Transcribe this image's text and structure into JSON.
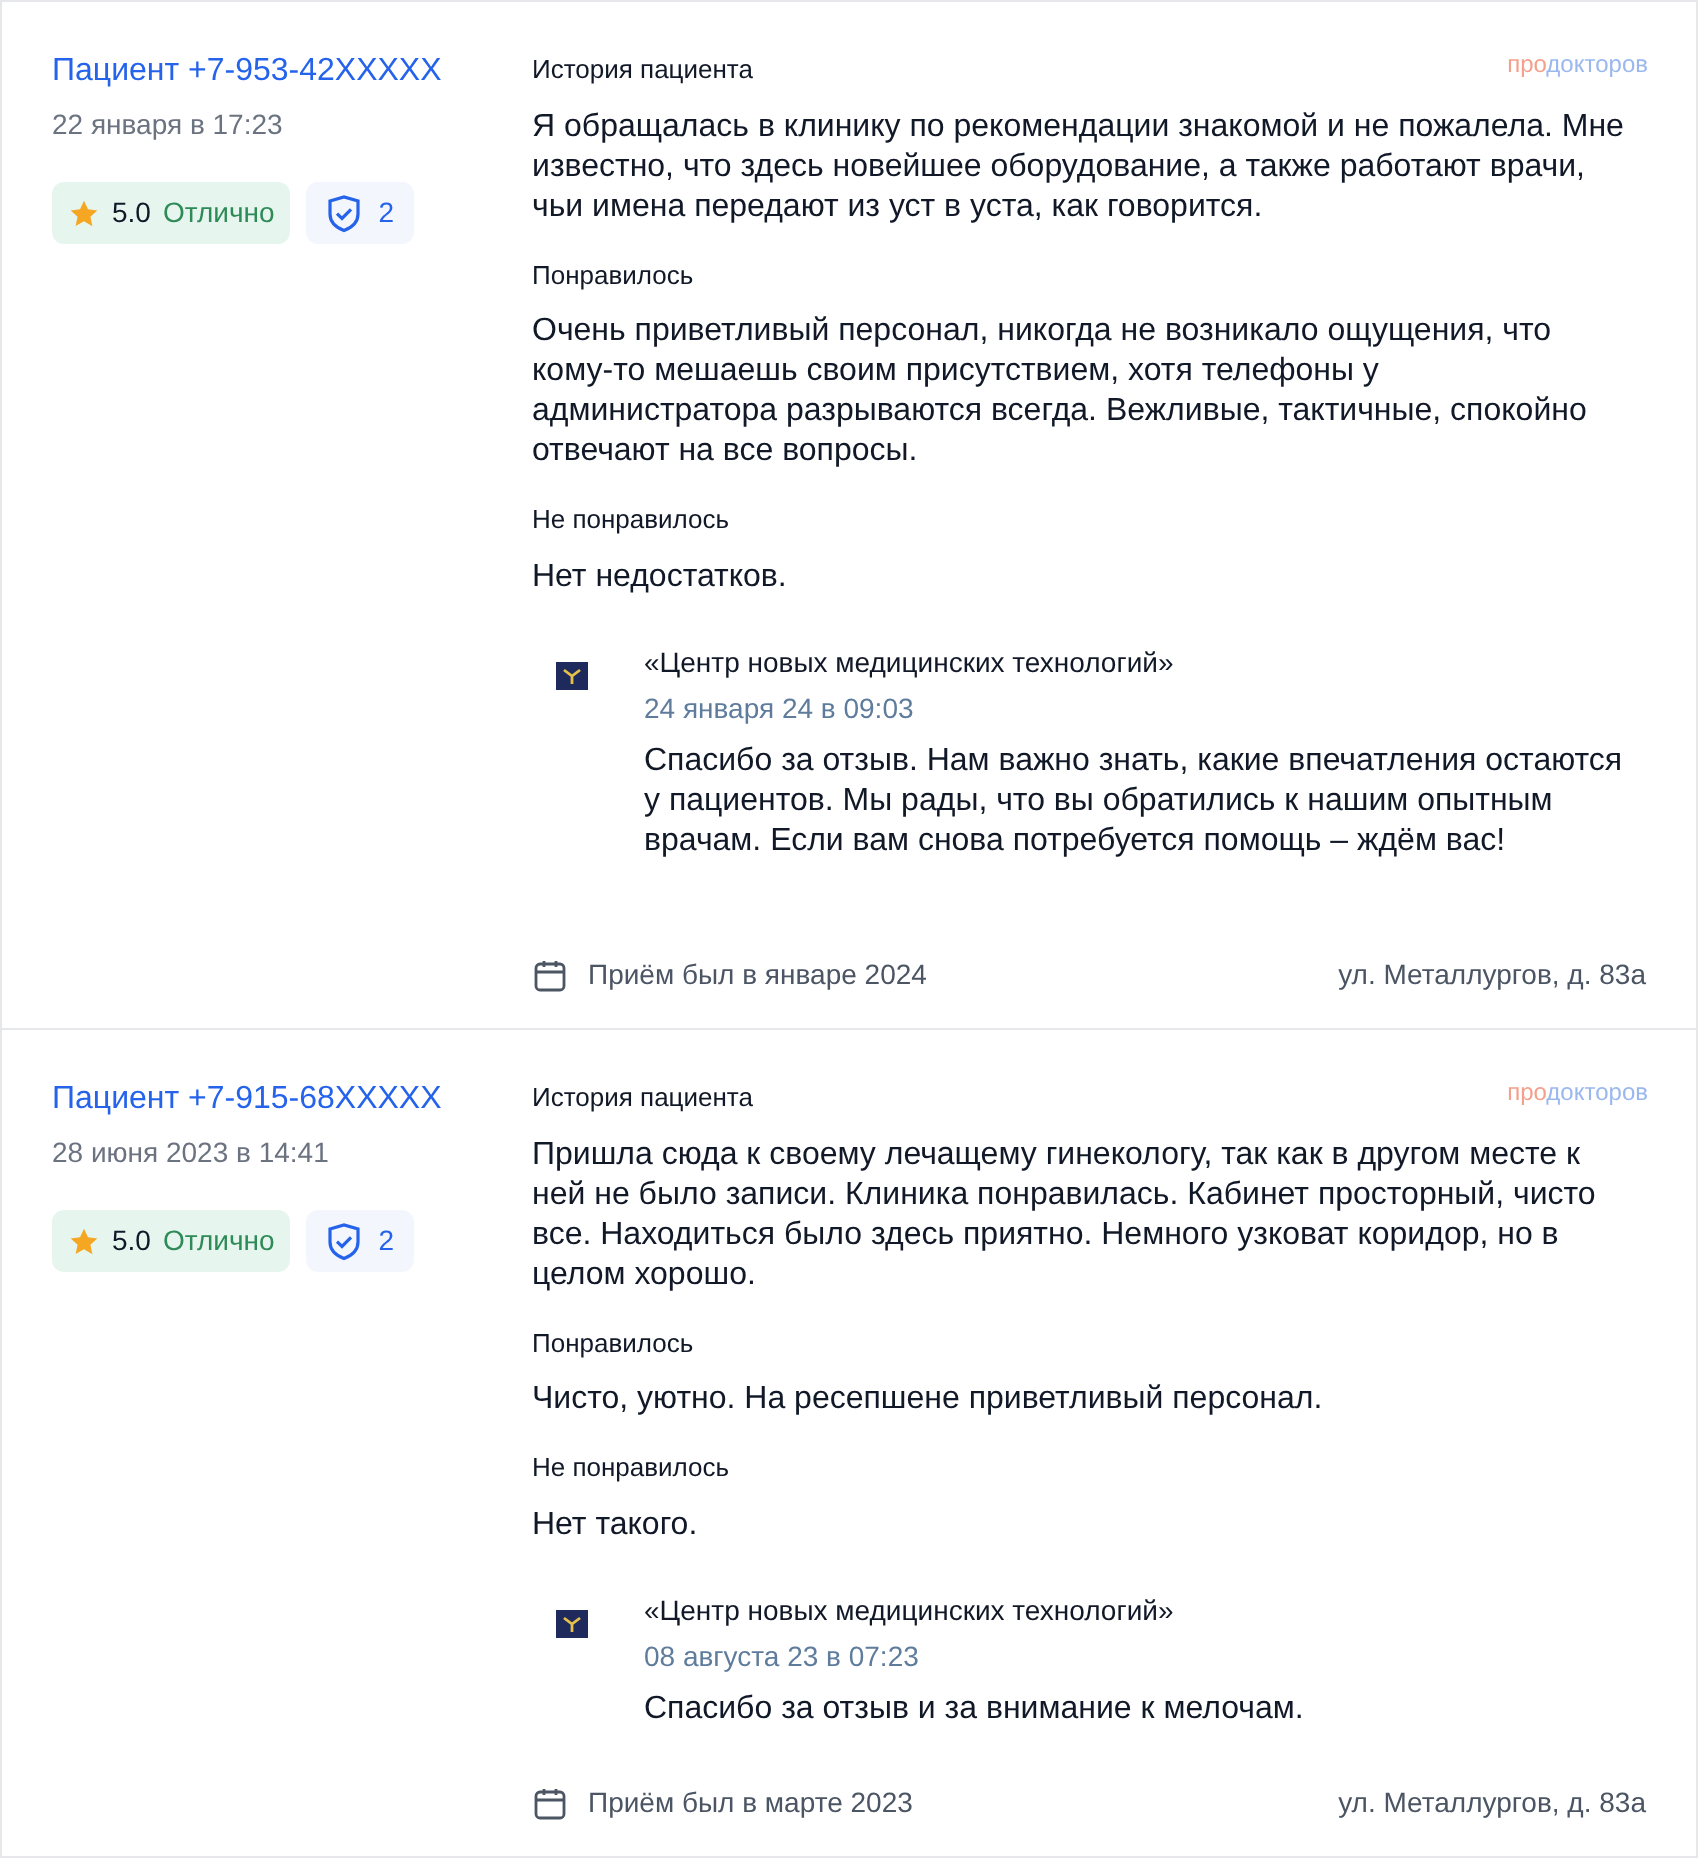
{
  "reviews": [
    {
      "author": "Пациент +7-953-42XXXXX",
      "date": "22 января в 17:23",
      "rating": "5.0",
      "rating_label": "Отлично",
      "verified_count": "2",
      "logo_prefix": "про",
      "logo_rest": "докторов",
      "sections": [
        {
          "title": "История пациента",
          "text": "Я обращалась в клинику по рекомендации знакомой и не пожалела. Мне известно, что здесь новейшее оборудование, а также работают врачи, чьи имена передают из уст в уста, как говорится."
        },
        {
          "title": "Понравилось",
          "text": "Очень приветливый персонал, никогда не возникало ощущения, что кому-то мешаешь своим присутствием, хотя телефоны у администратора разрываются всегда. Вежливые, тактичные, спокойно отвечают на все вопросы."
        },
        {
          "title": "Не понравилось",
          "text": "Нет недостатков."
        }
      ],
      "reply": {
        "clinic": "«Центр новых медицинских технологий»",
        "date": "24 января 24 в 09:03",
        "text": "Спасибо за отзыв. Нам важно знать, какие впечатления остаются у пациентов. Мы рады, что вы обратились к нашим опытным врачам. Если вам снова потребуется помощь – ждём вас!"
      },
      "visit": "Приём был в январе 2024",
      "address": "ул. Металлургов, д. 83а"
    },
    {
      "author": "Пациент +7-915-68XXXXX",
      "date": "28 июня 2023 в 14:41",
      "rating": "5.0",
      "rating_label": "Отлично",
      "verified_count": "2",
      "logo_prefix": "про",
      "logo_rest": "докторов",
      "sections": [
        {
          "title": "История пациента",
          "text": "Пришла сюда к своему лечащему гинекологу, так как в другом месте к ней не было записи. Клиника понравилась. Кабинет просторный, чисто все. Находиться было здесь приятно. Немного узковат коридор, но в целом хорошо."
        },
        {
          "title": "Понравилось",
          "text": "Чисто, уютно. На ресепшене приветливый персонал."
        },
        {
          "title": "Не понравилось",
          "text": "Нет такого."
        }
      ],
      "reply": {
        "clinic": "«Центр новых медицинских технологий»",
        "date": "08 августа 23 в 07:23",
        "text": "Спасибо за отзыв и за внимание к мелочам."
      },
      "visit": "Приём был в марте 2023",
      "address": "ул. Металлургов, д. 83а"
    }
  ]
}
